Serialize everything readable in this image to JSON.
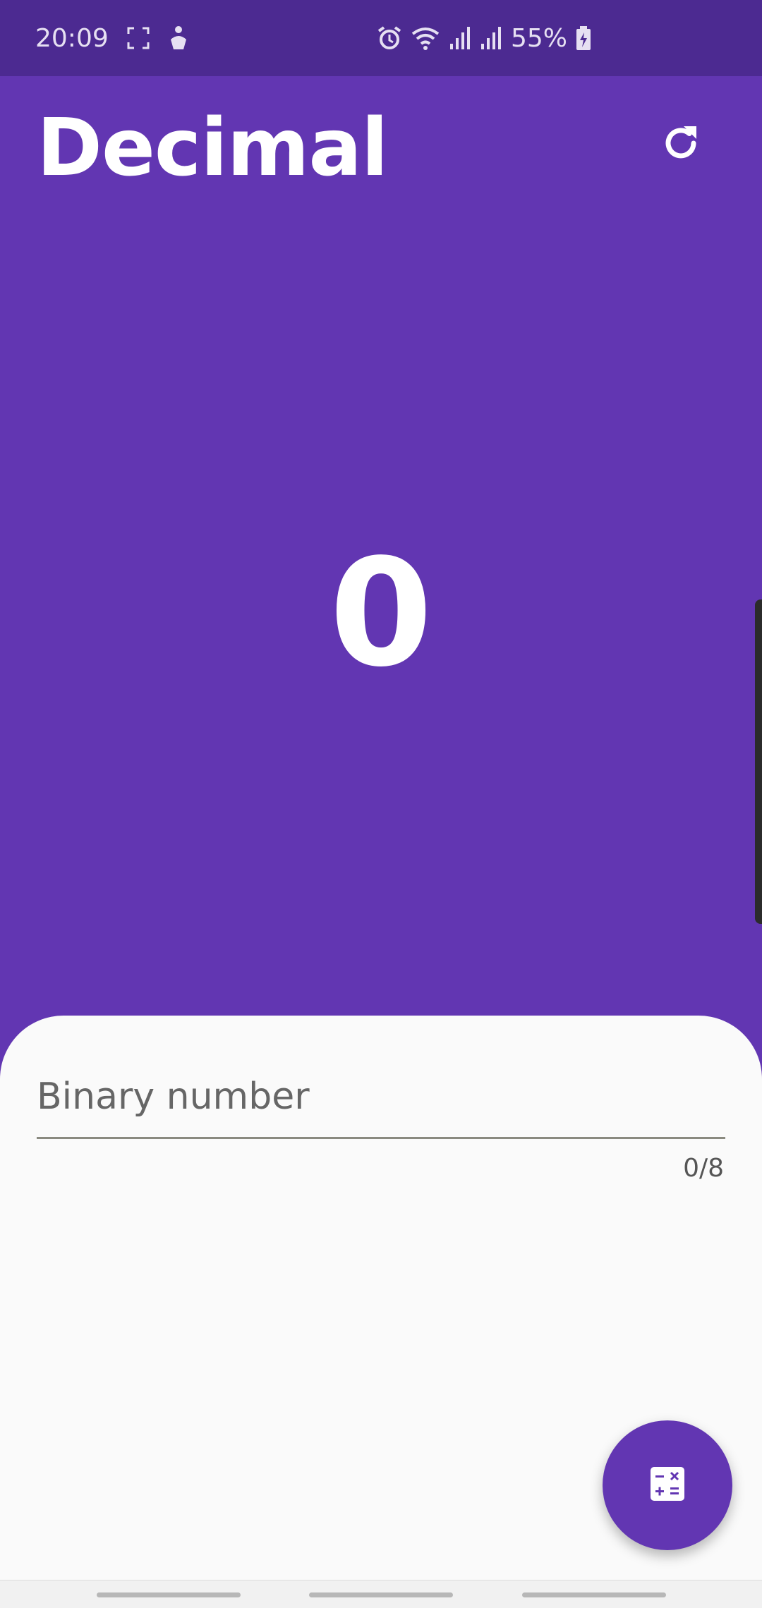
{
  "status_bar": {
    "time": "20:09",
    "battery": "55%",
    "icons": [
      "screenshot-icon",
      "accessibility-icon",
      "alarm-icon",
      "wifi-icon",
      "signal-icon",
      "signal-icon",
      "battery-charging-icon"
    ]
  },
  "header": {
    "title": "Decimal",
    "refresh_icon": "refresh-icon"
  },
  "result": {
    "value": "0"
  },
  "input": {
    "placeholder": "Binary number",
    "value": "",
    "counter": "0/8"
  },
  "fab": {
    "icon": "calculator-icon"
  },
  "colors": {
    "primary": "#6236b2",
    "status_bar": "#4c2a91",
    "sheet": "#fafafa"
  }
}
